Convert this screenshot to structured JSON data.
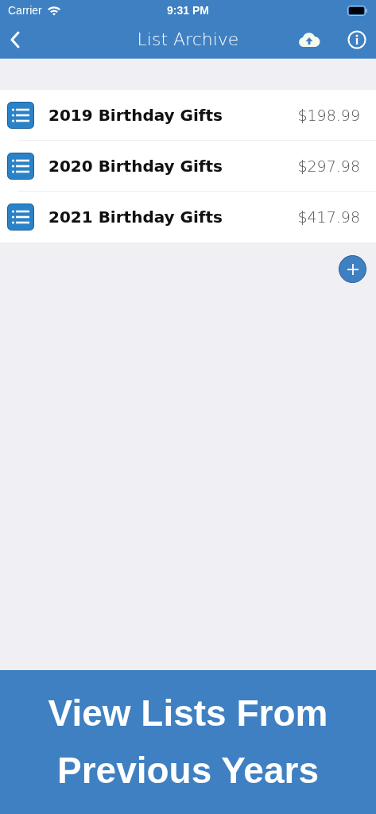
{
  "status_bar": {
    "carrier": "Carrier",
    "time": "9:31 PM"
  },
  "nav": {
    "title": "List Archive"
  },
  "lists": [
    {
      "name": "2019 Birthday Gifts",
      "total": "$198.99"
    },
    {
      "name": "2020 Birthday Gifts",
      "total": "$297.98"
    },
    {
      "name": "2021 Birthday Gifts",
      "total": "$417.98"
    }
  ],
  "banner": {
    "text": "View Lists From Previous Years"
  }
}
